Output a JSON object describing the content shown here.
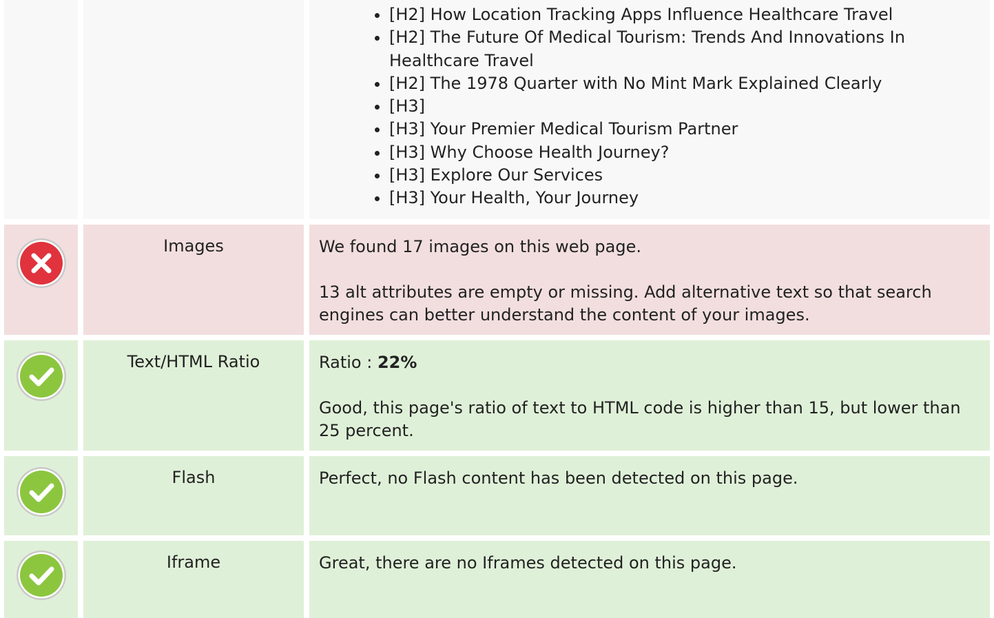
{
  "headings_list": {
    "items": [
      "[H2] How Location Tracking Apps Influence Healthcare Travel",
      "[H2] The Future Of Medical Tourism: Trends And Innovations In Healthcare Travel",
      "[H2] The 1978 Quarter with No Mint Mark Explained Clearly",
      "[H3]",
      "[H3] Your Premier Medical Tourism Partner",
      "[H3] Why Choose Health Journey?",
      "[H3] Explore Our Services",
      "[H3] Your Health, Your Journey"
    ]
  },
  "images": {
    "status": "error",
    "label": "Images",
    "line1": "We found 17 images on this web page.",
    "line2": "13 alt attributes are empty or missing. Add alternative text so that search engines can better understand the content of your images."
  },
  "text_html_ratio": {
    "status": "success",
    "label": "Text/HTML Ratio",
    "ratio_prefix": "Ratio : ",
    "ratio_value": "22%",
    "line2": "Good, this page's ratio of text to HTML code is higher than 15, but lower than 25 percent."
  },
  "flash": {
    "status": "success",
    "label": "Flash",
    "line1": "Perfect, no Flash content has been detected on this page."
  },
  "iframe": {
    "status": "success",
    "label": "Iframe",
    "line1": "Great, there are no Iframes detected on this page."
  },
  "colors": {
    "error_bg": "#f2dede",
    "success_bg": "#dff0d8",
    "neutral_bg": "#f8f8f8",
    "error_icon": "#e0333d",
    "success_icon": "#8cc63f"
  }
}
